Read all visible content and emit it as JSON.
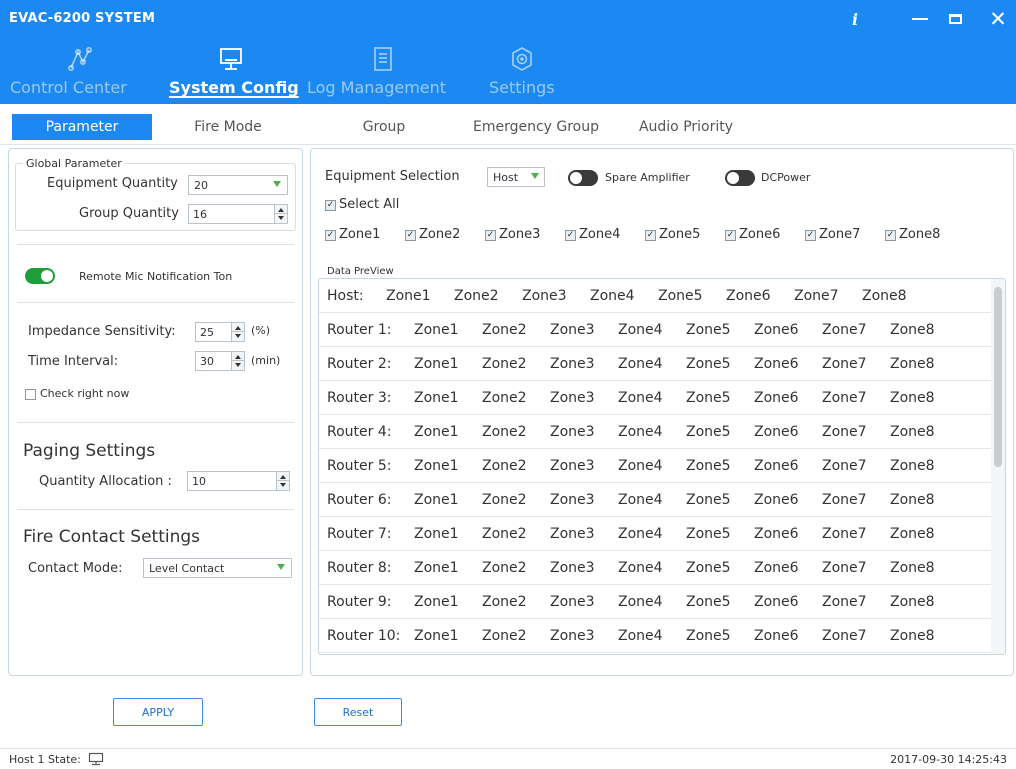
{
  "window": {
    "title": "EVAC-6200 SYSTEM",
    "controls": {
      "info": "i",
      "close": "✕"
    }
  },
  "nav": [
    {
      "label": "Control Center",
      "icon": "network-icon",
      "active": false
    },
    {
      "label": "System Config",
      "icon": "monitor-icon",
      "active": true
    },
    {
      "label": "Log Management",
      "icon": "document-icon",
      "active": false
    },
    {
      "label": "Settings",
      "icon": "gear-icon",
      "active": false
    }
  ],
  "tabs": [
    {
      "label": "Parameter",
      "active": true
    },
    {
      "label": "Fire Mode",
      "active": false
    },
    {
      "label": "Group",
      "active": false
    },
    {
      "label": "Emergency Group",
      "active": false
    },
    {
      "label": "Audio Priority",
      "active": false
    }
  ],
  "global_parameter": {
    "title": "Global Parameter",
    "equipment_quantity": {
      "label": "Equipment Quantity",
      "value": "20"
    },
    "group_quantity": {
      "label": "Group Quantity",
      "value": "16"
    }
  },
  "remote_mic": {
    "label": "Remote Mic Notification Ton",
    "on": true
  },
  "impedance": {
    "label": "Impedance Sensitivity:",
    "value": "25",
    "unit": "(%)"
  },
  "time_interval": {
    "label": "Time Interval:",
    "value": "30",
    "unit": "(min)"
  },
  "check_now": {
    "label": "Check right now",
    "checked": false
  },
  "paging": {
    "title": "Paging Settings",
    "label": "Quantity Allocation :",
    "value": "10"
  },
  "fire_contact": {
    "title": "Fire Contact Settings",
    "label": "Contact Mode:",
    "value": "Level Contact"
  },
  "equipment": {
    "label": "Equipment Selection",
    "value": "Host",
    "spare_amplifier": {
      "label": "Spare Amplifier",
      "on": false
    },
    "dcpower": {
      "label": "DCPower",
      "on": false
    },
    "select_all": {
      "label": "Select All",
      "checked": true
    },
    "zones": [
      {
        "label": "Zone1",
        "checked": true
      },
      {
        "label": "Zone2",
        "checked": true
      },
      {
        "label": "Zone3",
        "checked": true
      },
      {
        "label": "Zone4",
        "checked": true
      },
      {
        "label": "Zone5",
        "checked": true
      },
      {
        "label": "Zone6",
        "checked": true
      },
      {
        "label": "Zone7",
        "checked": true
      },
      {
        "label": "Zone8",
        "checked": true
      }
    ]
  },
  "preview": {
    "title": "Data PreView",
    "rows": [
      {
        "label": "Host:",
        "zones": [
          "Zone1",
          "Zone2",
          "Zone3",
          "Zone4",
          "Zone5",
          "Zone6",
          "Zone7",
          "Zone8"
        ]
      },
      {
        "label": "Router 1:",
        "zones": [
          "Zone1",
          "Zone2",
          "Zone3",
          "Zone4",
          "Zone5",
          "Zone6",
          "Zone7",
          "Zone8"
        ]
      },
      {
        "label": "Router 2:",
        "zones": [
          "Zone1",
          "Zone2",
          "Zone3",
          "Zone4",
          "Zone5",
          "Zone6",
          "Zone7",
          "Zone8"
        ]
      },
      {
        "label": "Router 3:",
        "zones": [
          "Zone1",
          "Zone2",
          "Zone3",
          "Zone4",
          "Zone5",
          "Zone6",
          "Zone7",
          "Zone8"
        ]
      },
      {
        "label": "Router 4:",
        "zones": [
          "Zone1",
          "Zone2",
          "Zone3",
          "Zone4",
          "Zone5",
          "Zone6",
          "Zone7",
          "Zone8"
        ]
      },
      {
        "label": "Router 5:",
        "zones": [
          "Zone1",
          "Zone2",
          "Zone3",
          "Zone4",
          "Zone5",
          "Zone6",
          "Zone7",
          "Zone8"
        ]
      },
      {
        "label": "Router 6:",
        "zones": [
          "Zone1",
          "Zone2",
          "Zone3",
          "Zone4",
          "Zone5",
          "Zone6",
          "Zone7",
          "Zone8"
        ]
      },
      {
        "label": "Router 7:",
        "zones": [
          "Zone1",
          "Zone2",
          "Zone3",
          "Zone4",
          "Zone5",
          "Zone6",
          "Zone7",
          "Zone8"
        ]
      },
      {
        "label": "Router 8:",
        "zones": [
          "Zone1",
          "Zone2",
          "Zone3",
          "Zone4",
          "Zone5",
          "Zone6",
          "Zone7",
          "Zone8"
        ]
      },
      {
        "label": "Router 9:",
        "zones": [
          "Zone1",
          "Zone2",
          "Zone3",
          "Zone4",
          "Zone5",
          "Zone6",
          "Zone7",
          "Zone8"
        ]
      },
      {
        "label": "Router 10:",
        "zones": [
          "Zone1",
          "Zone2",
          "Zone3",
          "Zone4",
          "Zone5",
          "Zone6",
          "Zone7",
          "Zone8"
        ]
      }
    ]
  },
  "buttons": {
    "apply": "APPLY",
    "reset": "Reset"
  },
  "status": {
    "host_state": "Host 1 State:",
    "datetime": "2017-09-30 14:25:43"
  }
}
